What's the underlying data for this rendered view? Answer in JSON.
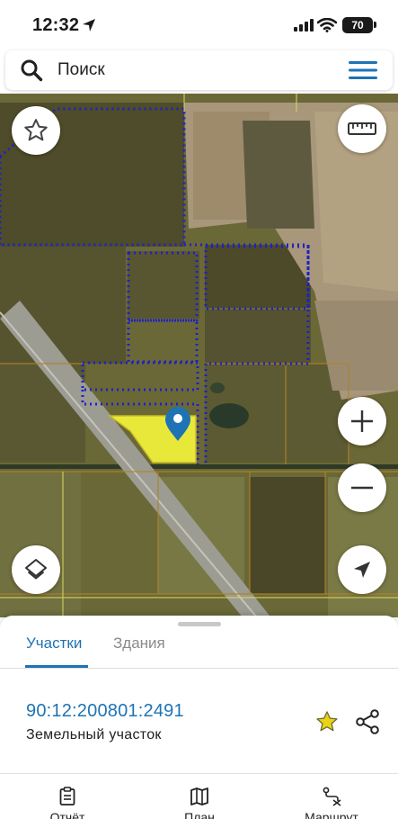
{
  "status_bar": {
    "time": "12:32",
    "battery": "70"
  },
  "search": {
    "placeholder": "Поиск"
  },
  "map": {
    "selected_parcel_color": "#e8e83a",
    "parcel_border_color": "#2020c8",
    "marker_color": "#1e73b5"
  },
  "sheet": {
    "tabs": [
      {
        "label": "Участки",
        "active": true
      },
      {
        "label": "Здания",
        "active": false
      }
    ],
    "parcel": {
      "number": "90:12:200801:2491",
      "type": "Земельный участок"
    }
  },
  "bottom_nav": [
    {
      "label": "Отчёт",
      "icon": "report-icon"
    },
    {
      "label": "План",
      "icon": "map-icon"
    },
    {
      "label": "Маршрут",
      "icon": "route-icon"
    }
  ],
  "colors": {
    "accent": "#1e73b5",
    "star": "#e8d21a"
  }
}
